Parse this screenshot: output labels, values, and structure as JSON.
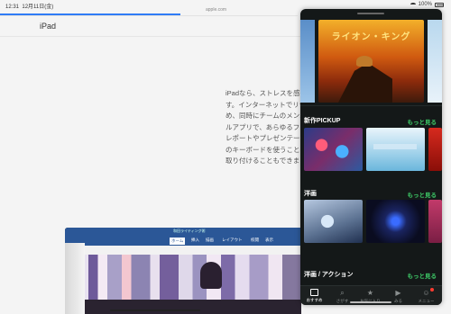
{
  "status_bar": {
    "time": "12:31",
    "date": "12月11日(金)",
    "url": "apple.com",
    "battery": "100%"
  },
  "page": {
    "heading": "iPad",
    "paragraph_lines": [
      "iPadなら、ストレスを感じ",
      "す。インターネットでリサー",
      "め、同時にチームのメンバ",
      "ルアプリで、あらゆるファ",
      "レポートやプレゼンテーシ",
      "のキーボードを使うことも",
      "取り付けることもできます"
    ]
  },
  "ipad_mockup": {
    "title": "和田ライティング術",
    "tabs": [
      "ホーム",
      "挿入",
      "描画",
      "レイアウト",
      "校閲",
      "表示"
    ]
  },
  "panel": {
    "hero_title": "ライオン・キング",
    "sections": [
      {
        "title": "新作PICKUP",
        "more": "もっと見る",
        "captions": [
          "",
          "",
          ""
        ]
      },
      {
        "title": "洋画",
        "more": "もっと見る",
        "captions": [
          "",
          "",
          ""
        ]
      },
      {
        "title": "洋画 / アクション",
        "more": "もっと見る"
      }
    ],
    "tabs": [
      {
        "label": "おすすめ",
        "icon": "home-icon"
      },
      {
        "label": "さがす",
        "icon": "search-icon"
      },
      {
        "label": "お気に入り",
        "icon": "star-icon"
      },
      {
        "label": "みる",
        "icon": "play-icon"
      },
      {
        "label": "メニュー",
        "icon": "user-icon"
      }
    ],
    "accent_color": "#3fd06a"
  }
}
